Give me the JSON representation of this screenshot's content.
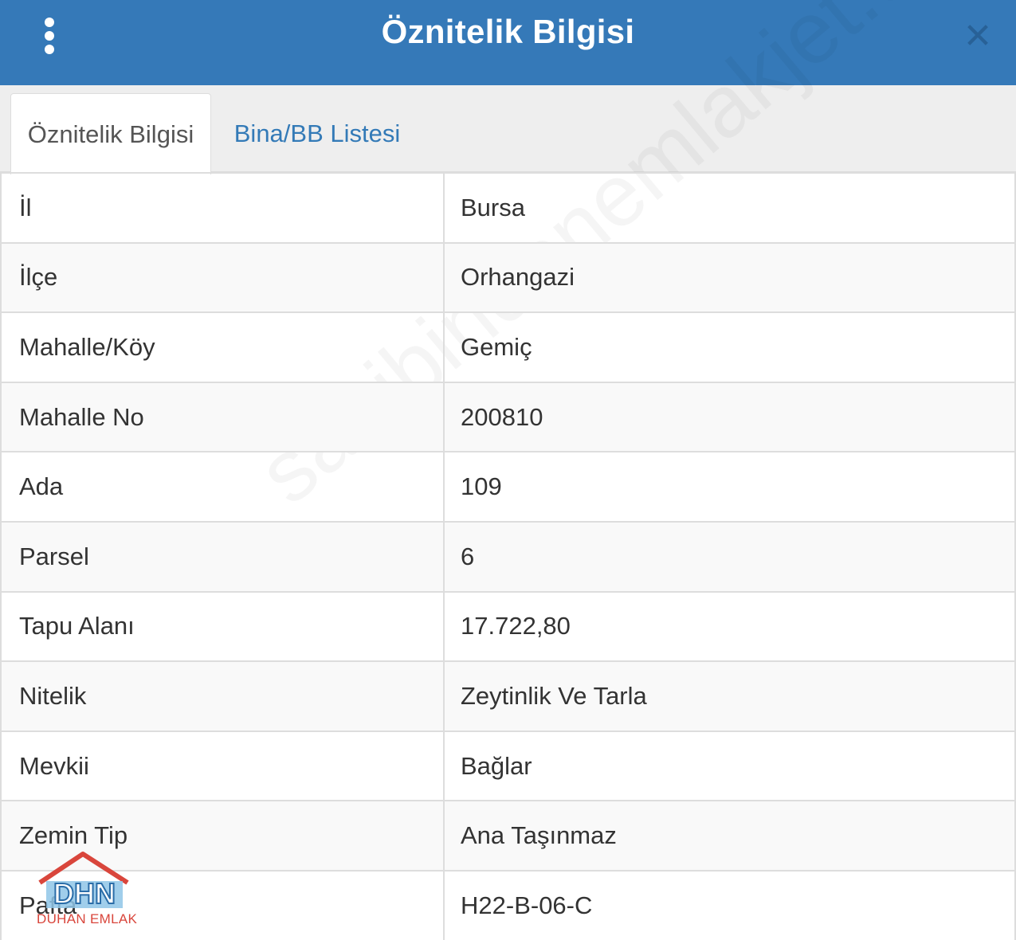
{
  "header": {
    "title": "Öznitelik Bilgisi",
    "menu_icon": "vertical-ellipsis-icon",
    "close_icon": "close-icon"
  },
  "tabs": [
    {
      "label": "Öznitelik Bilgisi",
      "active": true
    },
    {
      "label": "Bina/BB Listesi",
      "active": false
    }
  ],
  "rows": [
    {
      "key": "İl",
      "value": "Bursa"
    },
    {
      "key": "İlçe",
      "value": "Orhangazi"
    },
    {
      "key": "Mahalle/Köy",
      "value": "Gemiç"
    },
    {
      "key": "Mahalle No",
      "value": "200810"
    },
    {
      "key": "Ada",
      "value": "109"
    },
    {
      "key": "Parsel",
      "value": "6"
    },
    {
      "key": "Tapu Alanı",
      "value": "17.722,80"
    },
    {
      "key": "Nitelik",
      "value": "Zeytinlik Ve Tarla"
    },
    {
      "key": "Mevkii",
      "value": "Bağlar"
    },
    {
      "key": "Zemin Tip",
      "value": "Ana Taşınmaz"
    },
    {
      "key": "Pafta",
      "value": "H22-B-06-C"
    }
  ],
  "watermark": "sahibindenemlakjet.com",
  "logo": {
    "letters": "DHN",
    "caption": "DUHAN EMLAK"
  },
  "colors": {
    "header_bg": "#3579b8",
    "tab_link": "#337ab7",
    "border": "#dddddd",
    "stripe": "#f9f9f9"
  }
}
